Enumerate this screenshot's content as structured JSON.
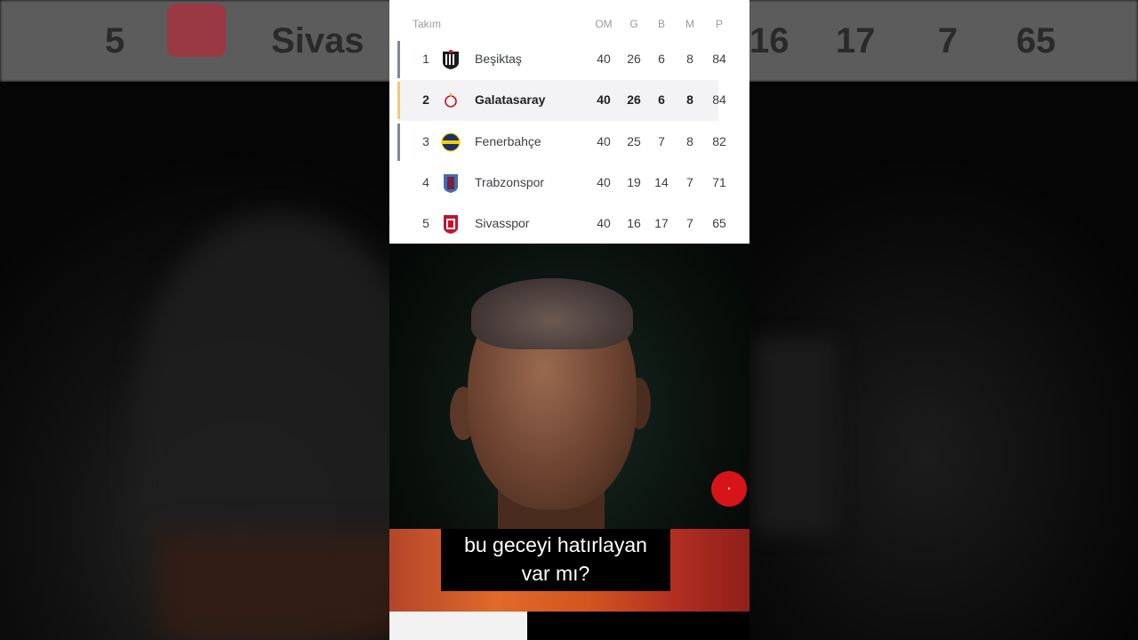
{
  "background": {
    "top_row": {
      "rank": "5",
      "team": "Sivas",
      "played": "16",
      "won": "17",
      "drawn": "7",
      "points": "65"
    }
  },
  "standings": {
    "header": {
      "team": "Takım",
      "played": "OM",
      "won": "G",
      "drawn": "B",
      "lost": "M",
      "points": "P"
    },
    "rows": [
      {
        "rank": "1",
        "team": "Beşiktaş",
        "played": "40",
        "won": "26",
        "drawn": "6",
        "lost": "8",
        "points": "84",
        "crest_color": "#1a1a1a",
        "bar_color": "#7b8b95"
      },
      {
        "rank": "2",
        "team": "Galatasaray",
        "played": "40",
        "won": "26",
        "drawn": "6",
        "lost": "8",
        "points": "84",
        "crest_color": "#c8102e",
        "bar_color": "#f3c87a"
      },
      {
        "rank": "3",
        "team": "Fenerbahçe",
        "played": "40",
        "won": "25",
        "drawn": "7",
        "lost": "8",
        "points": "82",
        "crest_color": "#1b2f6b",
        "bar_color": "#7b8b95"
      },
      {
        "rank": "4",
        "team": "Trabzonspor",
        "played": "40",
        "won": "19",
        "drawn": "14",
        "lost": "7",
        "points": "71",
        "crest_color": "#3d6fb5",
        "bar_color": ""
      },
      {
        "rank": "5",
        "team": "Sivasspor",
        "played": "40",
        "won": "16",
        "drawn": "17",
        "lost": "7",
        "points": "65",
        "crest_color": "#c8102e",
        "bar_color": ""
      }
    ]
  },
  "caption": {
    "line1": "bu geceyi hatırlayan",
    "line2": "var mı?"
  },
  "colors": {
    "highlight_row": "#f3f3f5",
    "watermark": "#d8141b"
  }
}
